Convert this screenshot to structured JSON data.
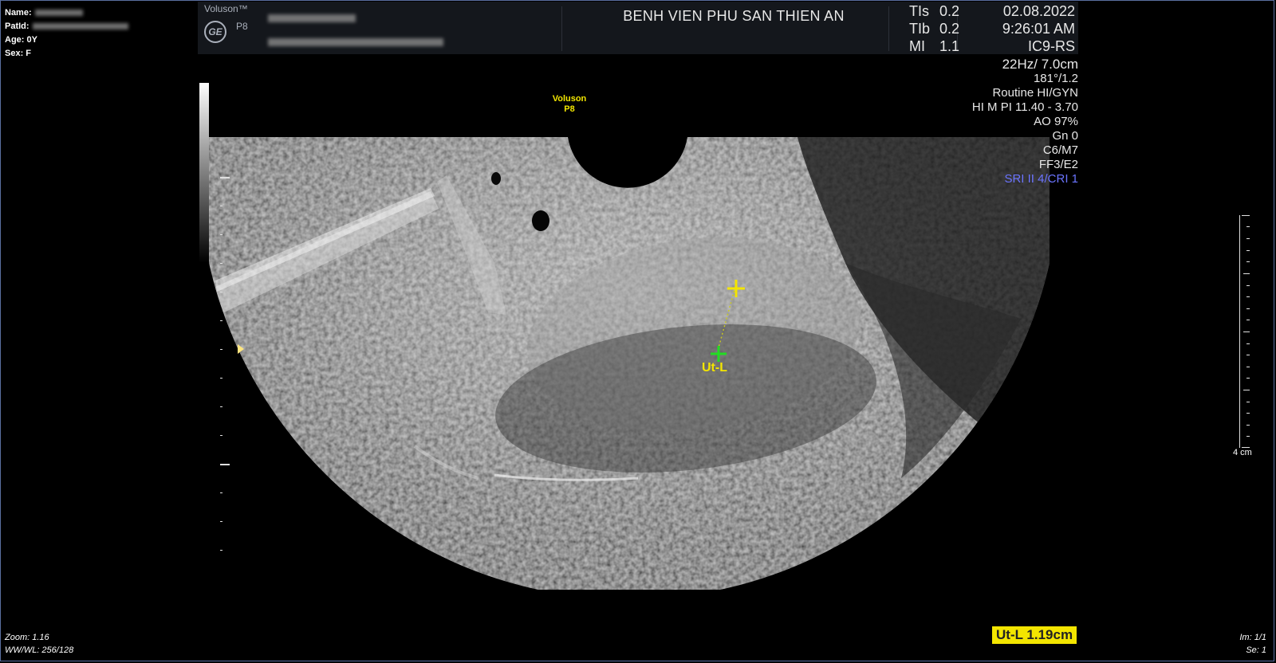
{
  "patient": {
    "name_label": "Name:",
    "patid_label": "PatId:",
    "age": "Age: 0Y",
    "sex": "Sex: F"
  },
  "header": {
    "brand": "Voluson™",
    "logo": "GE",
    "model": "P8",
    "hospital": "BENH VIEN PHU SAN THIEN AN",
    "tis": {
      "label": "TIs",
      "value": "0.2"
    },
    "tib": {
      "label": "TIb",
      "value": "0.2"
    },
    "mi": {
      "label": "MI",
      "value": "1.1"
    },
    "date": "02.08.2022",
    "time": "9:26:01 AM",
    "probe": "IC9-RS"
  },
  "parameters": [
    "22Hz/ 7.0cm",
    "181°/1.2",
    "Routine HI/GYN",
    "HI M PI 11.40 - 3.70",
    "AO 97%",
    "Gn  0",
    "C6/M7",
    "FF3/E2",
    "SRI II 4/CRI 1"
  ],
  "overlay": {
    "voluson_brand": "Voluson",
    "voluson_model": "P8",
    "caliper_label": "Ut-L"
  },
  "measurement": {
    "result": "Ut-L 1.19cm"
  },
  "scale": {
    "label": "4 cm"
  },
  "viewer": {
    "zoom": "Zoom: 1.16",
    "wwwl": "WW/WL: 256/128",
    "image_no": "Im: 1/1",
    "series_no": "Se: 1"
  },
  "colors": {
    "caliper_yellow": "#f3e500",
    "caliper_green": "#22dd22",
    "sri_blue": "#6b74ff",
    "frame_border": "#5a6fa0"
  }
}
